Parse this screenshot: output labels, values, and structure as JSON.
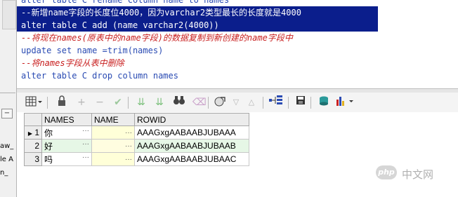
{
  "editor": {
    "line0": "alter table C rename column name to names",
    "line1": "--新增name字段的长度位4000，因为varchar2类型最长的长度就是4000",
    "line2": "alter table C add (name varchar2(4000))",
    "line3": "--将现在names(原表中的name字段)的数据复制到新创建的name字段中",
    "line4": "update set name =trim(names)",
    "line5": "--将names字段从表中删除",
    "line6": "alter table C drop column names"
  },
  "left_panel": {
    "labels": [
      "aw_",
      "le A",
      "n_"
    ],
    "minus_btn": "−"
  },
  "toolbar": {
    "icons": [
      "grid-view-icon",
      "lock-icon",
      "plus-icon",
      "minus-icon",
      "check-icon",
      "double-down-icon",
      "double-down-alt-icon",
      "binoculars-icon",
      "eraser-icon",
      "export-icon",
      "triangle-down-icon",
      "triangle-up-icon",
      "tree-icon",
      "save-icon",
      "database-icon",
      "chart-icon"
    ]
  },
  "grid": {
    "columns": [
      "NAMES",
      "NAME",
      "ROWID"
    ],
    "rows": [
      {
        "num": "1",
        "names": "你",
        "name": "",
        "rowid": "AAAGxgAABAABJUBAAA"
      },
      {
        "num": "2",
        "names": "好",
        "name": "",
        "rowid": "AAAGxgAABAABJUBAAB"
      },
      {
        "num": "3",
        "names": "吗",
        "name": "",
        "rowid": "AAAGxgAABAABJUBAAC"
      }
    ],
    "ellipsis": "···"
  },
  "watermark": {
    "logo": "php",
    "text": "中文网"
  },
  "colors": {
    "selection": "#0b1e8c",
    "comment": "#c81e1e",
    "keyword": "#2a4bb3"
  }
}
